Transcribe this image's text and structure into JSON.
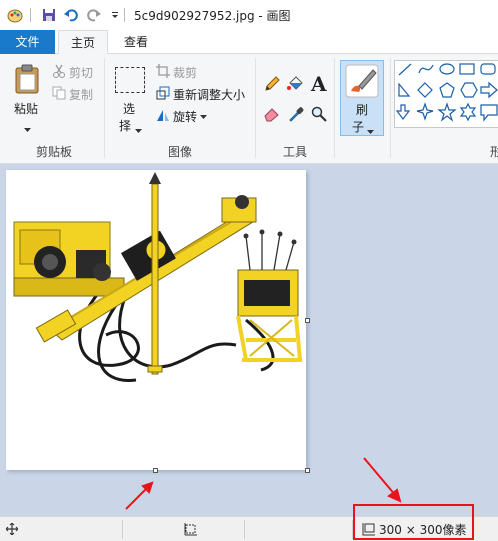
{
  "window": {
    "title": "5c9d902927952.jpg - 画图"
  },
  "tabs": {
    "file": "文件",
    "home": "主页",
    "view": "查看"
  },
  "ribbon": {
    "clipboard": {
      "paste": "粘贴",
      "cut": "剪切",
      "copy": "复制",
      "group": "剪贴板"
    },
    "image": {
      "select_1": "选",
      "select_2": "择",
      "crop": "裁剪",
      "resize": "重新调整大小",
      "rotate": "旋转",
      "group": "图像"
    },
    "tools": {
      "text": "A",
      "group": "工具"
    },
    "brushes": {
      "label_1": "刷",
      "label_2": "子"
    },
    "shapes": {
      "group": "形"
    }
  },
  "status": {
    "size": "300 × 300像素"
  },
  "colors": {
    "accent": "#1979ca",
    "workspace": "#cad6e7",
    "annotation": "#e8141a"
  }
}
